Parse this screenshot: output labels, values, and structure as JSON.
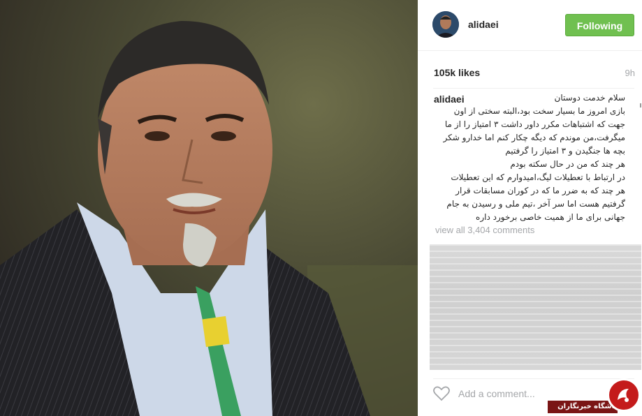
{
  "post": {
    "username": "alidaei",
    "follow_label": "Following",
    "likes": "105k likes",
    "time": "9h",
    "caption_user": "alidaei",
    "caption_lines": [
      "سلام خدمت دوستان",
      "بازی امروز ما بسیار سخت بود،البته سختی از اون",
      "جهت که اشتباهات مکرر داور داشت ۳ امتیاز را از ما",
      "میگرفت،من موندم که دیگه چکار کنم اما خدارو شکر",
      "بچه ها جنگیدن و ۳ امتیاز را گرفتیم",
      "هر چند که من در حال سکته بودم",
      "در ارتباط با تعطیلات لیگ،امیدوارم که این تعطیلات",
      "هر چند که به ضرر ما که در کوران مسابقات قرار",
      "گرفتیم هست اما سر آخر ،تیم ملی و رسیدن به جام",
      "جهانی برای ما از همیت خاصی برخورد داره"
    ],
    "view_all": "view all 3,404 comments",
    "add_comment_placeholder": "Add a comment..."
  },
  "badge": {
    "text": "باشگاه خبرنگاران"
  },
  "colors": {
    "follow_green": "#70c050",
    "badge_red": "#c41b1b"
  }
}
